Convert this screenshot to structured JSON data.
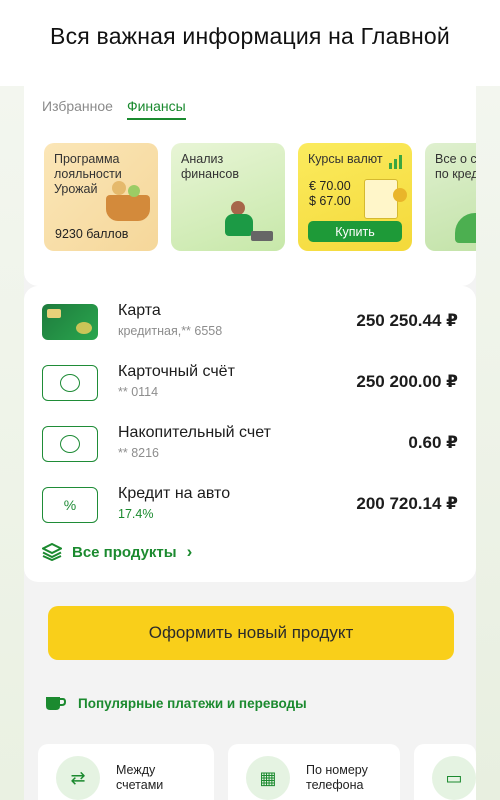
{
  "header": {
    "title": "Вся важная информация на Главной"
  },
  "tabs": [
    {
      "label": "Избранное",
      "active": false
    },
    {
      "label": "Финансы",
      "active": true
    }
  ],
  "tiles": [
    {
      "title": "Программа лояльности Урожай",
      "points": "9230 баллов"
    },
    {
      "title": "Анализ финансов"
    },
    {
      "title": "Курсы валют",
      "rate_eur": "€ 70.00",
      "rate_usd": "$ 67.00",
      "button": "Купить"
    },
    {
      "title": "Все о ст по кред"
    }
  ],
  "accounts": [
    {
      "name": "Карта",
      "sub": "кредитная,** 6558",
      "amount": "250 250.44 ₽",
      "icon": "credit-card-icon"
    },
    {
      "name": "Карточный счёт",
      "sub": "** 0114",
      "amount": "250 200.00 ₽",
      "icon": "coins-icon"
    },
    {
      "name": "Накопительный счет",
      "sub": "** 8216",
      "amount": "0.60 ₽",
      "icon": "coins-icon"
    },
    {
      "name": "Кредит на авто",
      "sub": "17.4%",
      "amount": "200 720.14 ₽",
      "icon": "percent-icon"
    }
  ],
  "all_products": {
    "label": "Все продукты"
  },
  "cta": {
    "label": "Оформить новый продукт"
  },
  "popular": {
    "label": "Популярные платежи и переводы"
  },
  "quick_actions": [
    {
      "label_line1": "Между",
      "label_line2": "счетами",
      "icon": "transfer-arrows-icon"
    },
    {
      "label_line1": "По номеру",
      "label_line2": "телефона",
      "icon": "phone-icon"
    },
    {
      "icon": "cards-icon"
    }
  ],
  "colors": {
    "accent": "#1b8a2f",
    "cta": "#f9cf1a"
  }
}
